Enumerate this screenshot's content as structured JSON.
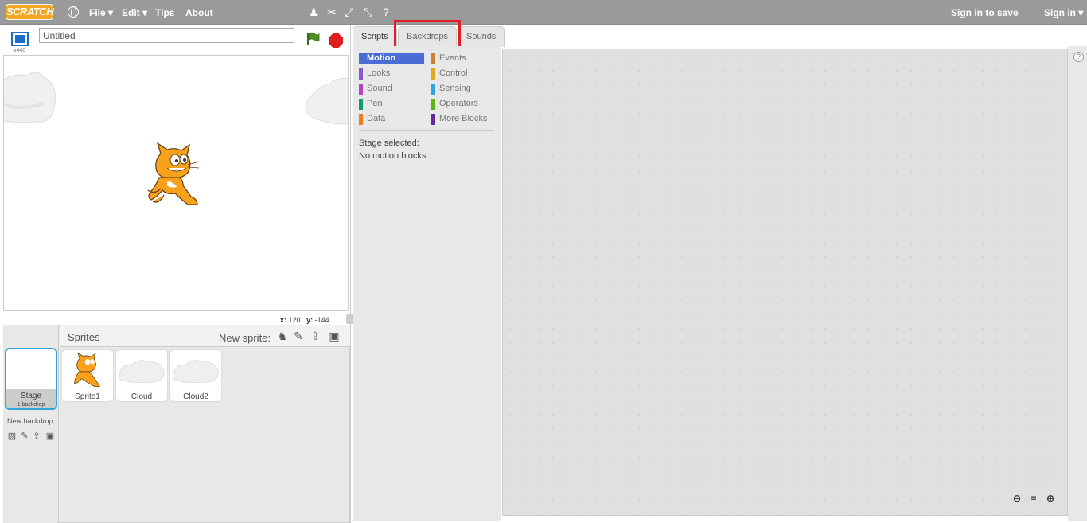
{
  "menubar": {
    "logo": "SCRATCH",
    "file": "File",
    "edit": "Edit",
    "tips": "Tips",
    "about": "About",
    "sign_in_to_save": "Sign in to save",
    "sign_in": "Sign in"
  },
  "stage": {
    "version": "v440",
    "title": "Untitled",
    "x_label": "x:",
    "x_value": "120",
    "y_label": "y:",
    "y_value": "-144"
  },
  "sprites": {
    "header": "Sprites",
    "new_sprite": "New sprite:",
    "items": [
      {
        "name": "Sprite1"
      },
      {
        "name": "Cloud"
      },
      {
        "name": "Cloud2"
      }
    ]
  },
  "stage_thumb": {
    "label": "Stage",
    "sub": "1 backdrop",
    "new_backdrop": "New backdrop:"
  },
  "tabs": [
    {
      "label": "Scripts"
    },
    {
      "label": "Backdrops"
    },
    {
      "label": "Sounds"
    }
  ],
  "categories": {
    "left": [
      {
        "label": "Motion",
        "color": "#4a6cd4"
      },
      {
        "label": "Looks",
        "color": "#8a55d7"
      },
      {
        "label": "Sound",
        "color": "#bb42c3"
      },
      {
        "label": "Pen",
        "color": "#0e9a6c"
      },
      {
        "label": "Data",
        "color": "#ee7d16"
      }
    ],
    "right": [
      {
        "label": "Events",
        "color": "#c88330"
      },
      {
        "label": "Control",
        "color": "#e1a91a"
      },
      {
        "label": "Sensing",
        "color": "#2ca5e2"
      },
      {
        "label": "Operators",
        "color": "#5cb712"
      },
      {
        "label": "More Blocks",
        "color": "#632d99"
      }
    ]
  },
  "palette_message": {
    "line1": "Stage selected:",
    "line2": "No motion blocks"
  },
  "zoom": {
    "out": "−",
    "reset": "=",
    "in": "+"
  },
  "colors": {
    "menubar": "#9a9a9a",
    "highlight": "#e01e2b",
    "accent": "#4a6cd4"
  }
}
